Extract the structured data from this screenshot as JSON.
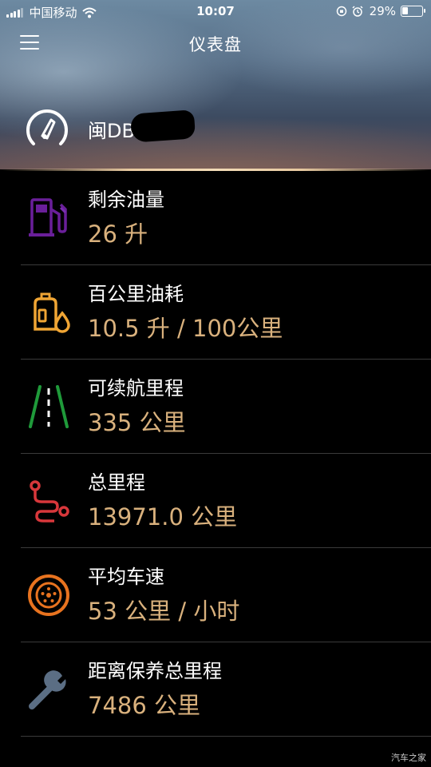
{
  "status_bar": {
    "carrier": "中国移动",
    "time": "10:07",
    "battery": "29%",
    "battery_level": 0.29
  },
  "nav": {
    "title": "仪表盘",
    "menu_icon": "hamburger-icon"
  },
  "vehicle": {
    "name": "闽DB",
    "icon": "speedometer-icon"
  },
  "items": [
    {
      "label": "剩余油量",
      "value": "26 升",
      "icon": "fuel-pump-icon",
      "color": "#6a1f9a"
    },
    {
      "label": "百公里油耗",
      "value": "10.5 升 / 100公里",
      "icon": "oil-can-icon",
      "color": "#f0a534"
    },
    {
      "label": "可续航里程",
      "value": "335 公里",
      "icon": "road-icon",
      "color": "#1f9a3a"
    },
    {
      "label": "总里程",
      "value": "13971.0 公里",
      "icon": "route-icon",
      "color": "#d8373b"
    },
    {
      "label": "平均车速",
      "value": "53 公里 / 小时",
      "icon": "tire-icon",
      "color": "#e8731f"
    },
    {
      "label": "距离保养总里程",
      "value": "7486 公里",
      "icon": "wrench-icon",
      "color": "#5b6e84"
    }
  ],
  "watermark": "汽车之家",
  "colors": {
    "value_text": "#d9b17d",
    "accent_line": "#e7c9a0",
    "divider": "#3a3a3a"
  }
}
